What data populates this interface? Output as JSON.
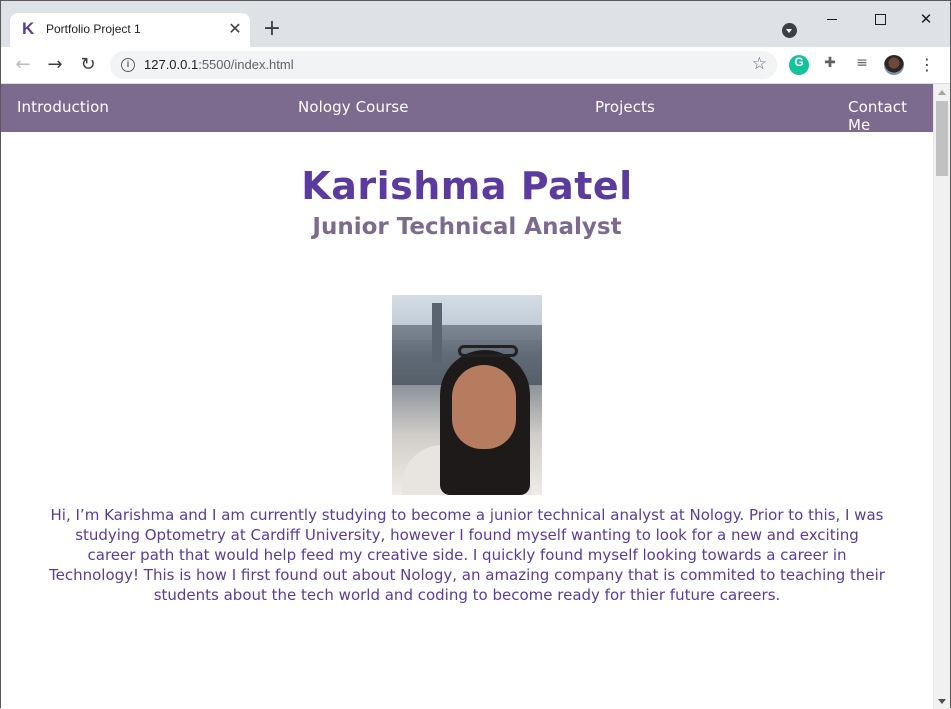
{
  "browser": {
    "tab_title": "Portfolio Project 1",
    "tab_favicon": "K",
    "tab_close": "✕",
    "new_tab": "+",
    "url_host": "127.0.0.1",
    "url_path": ":5500/index.html",
    "icons": {
      "back": "back-arrow-icon",
      "forward": "forward-arrow-icon",
      "reload": "reload-icon",
      "info": "info-icon",
      "star": "star-icon",
      "grammarly": "grammarly-icon",
      "extensions": "puzzle-icon",
      "media": "media-control-icon",
      "profile": "profile-avatar-icon",
      "menu": "more-vert-icon"
    }
  },
  "site": {
    "nav": {
      "introduction": "Introduction",
      "course": "Nology Course",
      "projects": "Projects",
      "contact": "Contact Me"
    },
    "name": "Karishma Patel",
    "job_title": "Junior Technical Analyst",
    "bio": "Hi, I’m Karishma and I am currently studying to become a junior technical analyst at Nology. Prior to this, I was studying Optometry at Cardiff University, however I found myself wanting to look for a new and exciting career path that would help feed my creative side. I quickly found myself looking towards a career in Technology! This is how I first found out about Nology, an amazing company that is commited to teaching their students about the tech world and coding to become ready for thier future careers."
  },
  "colors": {
    "nav_background": "#7c6a8f",
    "heading_purple": "#5b3b9e",
    "subheading": "#7c6a8f"
  }
}
